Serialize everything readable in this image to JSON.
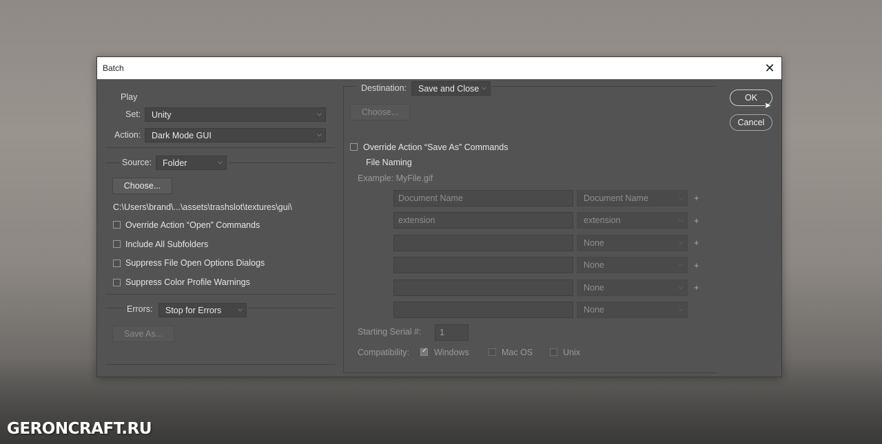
{
  "window": {
    "title": "Batch",
    "close_label": "✕"
  },
  "play": {
    "heading": "Play",
    "set_label": "Set:",
    "set_value": "Unity",
    "action_label": "Action:",
    "action_value": "Dark Mode GUI"
  },
  "source": {
    "label": "Source:",
    "value": "Folder",
    "choose_label": "Choose...",
    "path": "C:\\Users\\brand\\...\\assets\\trashslot\\textures\\gui\\",
    "options": [
      {
        "label": "Override Action “Open” Commands",
        "checked": false
      },
      {
        "label": "Include All Subfolders",
        "checked": false
      },
      {
        "label": "Suppress File Open Options Dialogs",
        "checked": false
      },
      {
        "label": "Suppress Color Profile Warnings",
        "checked": false
      }
    ]
  },
  "errors": {
    "label": "Errors:",
    "value": "Stop for Errors",
    "save_as_label": "Save As..."
  },
  "destination": {
    "label": "Destination:",
    "value": "Save and Close",
    "choose_label": "Choose...",
    "override_label": "Override Action “Save As” Commands",
    "override_checked": false
  },
  "file_naming": {
    "heading": "File Naming",
    "example": "Example: MyFile.gif",
    "rows": [
      {
        "text": "Document Name",
        "select": "Document Name",
        "plus": "+"
      },
      {
        "text": "extension",
        "select": "extension",
        "plus": "+"
      },
      {
        "text": "",
        "select": "None",
        "plus": "+"
      },
      {
        "text": "",
        "select": "None",
        "plus": "+"
      },
      {
        "text": "",
        "select": "None",
        "plus": "+"
      },
      {
        "text": "",
        "select": "None",
        "plus": ""
      }
    ],
    "serial_label": "Starting Serial #:",
    "serial_value": "1",
    "compat_label": "Compatibility:",
    "compat": [
      {
        "label": "Windows",
        "checked": true
      },
      {
        "label": "Mac OS",
        "checked": false
      },
      {
        "label": "Unix",
        "checked": false
      }
    ]
  },
  "buttons": {
    "ok": "OK",
    "cancel": "Cancel"
  },
  "watermark": "GERONCRAFT.RU"
}
